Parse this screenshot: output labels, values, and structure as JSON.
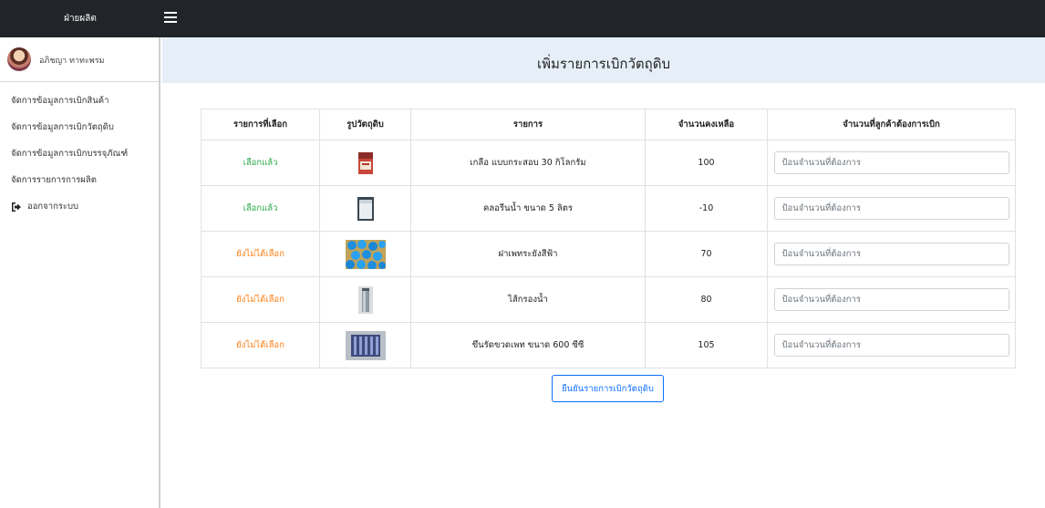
{
  "sidebar": {
    "brand": "ฝ่ายผลิต",
    "user_name": "อภิชญา ทาทะพรม",
    "items": [
      {
        "label": "จัดการข้อมูลการเบิกสินค้า"
      },
      {
        "label": "จัดการข้อมูลการเบิกวัตถุดิบ"
      },
      {
        "label": "จัดการข้อมูลการเบิกบรรจุภัณฑ์"
      },
      {
        "label": "จัดการรายการการผลิต"
      },
      {
        "label": "ออกจากระบบ",
        "icon": "logout-icon"
      }
    ]
  },
  "topbar": {
    "icon": "hamburger-menu-icon"
  },
  "header": {
    "title": "เพิ่มรายการเบิกวัตถุดิบ"
  },
  "table": {
    "columns": [
      "รายการที่เลือก",
      "รูปวัตถุดิบ",
      "รายการ",
      "จำนวนคงเหลือ",
      "จำนวนที่ลูกค้าต้องการเบิก"
    ],
    "rows": [
      {
        "status": "เลือกแล้ว",
        "status_color": "#28a745",
        "image": "salt-bag-image",
        "item": "เกลือ แบบกระสอบ 30 กิโลกรัม",
        "remaining": "100",
        "placeholder": "ป้อนจำนวนที่ต้องการ"
      },
      {
        "status": "เลือกแล้ว",
        "status_color": "#28a745",
        "image": "chlorine-bucket-image",
        "item": "คลอรีนน้ำ ขนาด 5 ลิตร",
        "remaining": "-10",
        "placeholder": "ป้อนจำนวนที่ต้องการ"
      },
      {
        "status": "ยังไม่ได้เลือก",
        "status_color": "#fd7e14",
        "image": "blue-caps-image",
        "item": "ฝาเพทระยังสีฟ้า",
        "remaining": "70",
        "placeholder": "ป้อนจำนวนที่ต้องการ"
      },
      {
        "status": "ยังไม่ได้เลือก",
        "status_color": "#fd7e14",
        "image": "water-filter-image",
        "item": "ไส้กรองน้ำ",
        "remaining": "80",
        "placeholder": "ป้อนจำนวนที่ต้องการ"
      },
      {
        "status": "ยังไม่ได้เลือก",
        "status_color": "#fd7e14",
        "image": "pet-bottles-image",
        "item": "ขึนรัดขวดเพท ขนาด 600 ซีซี",
        "remaining": "105",
        "placeholder": "ป้อนจำนวนที่ต้องการ"
      }
    ]
  },
  "actions": {
    "confirm_label": "ยืนยันรายการเบิกวัตถุดิบ"
  }
}
